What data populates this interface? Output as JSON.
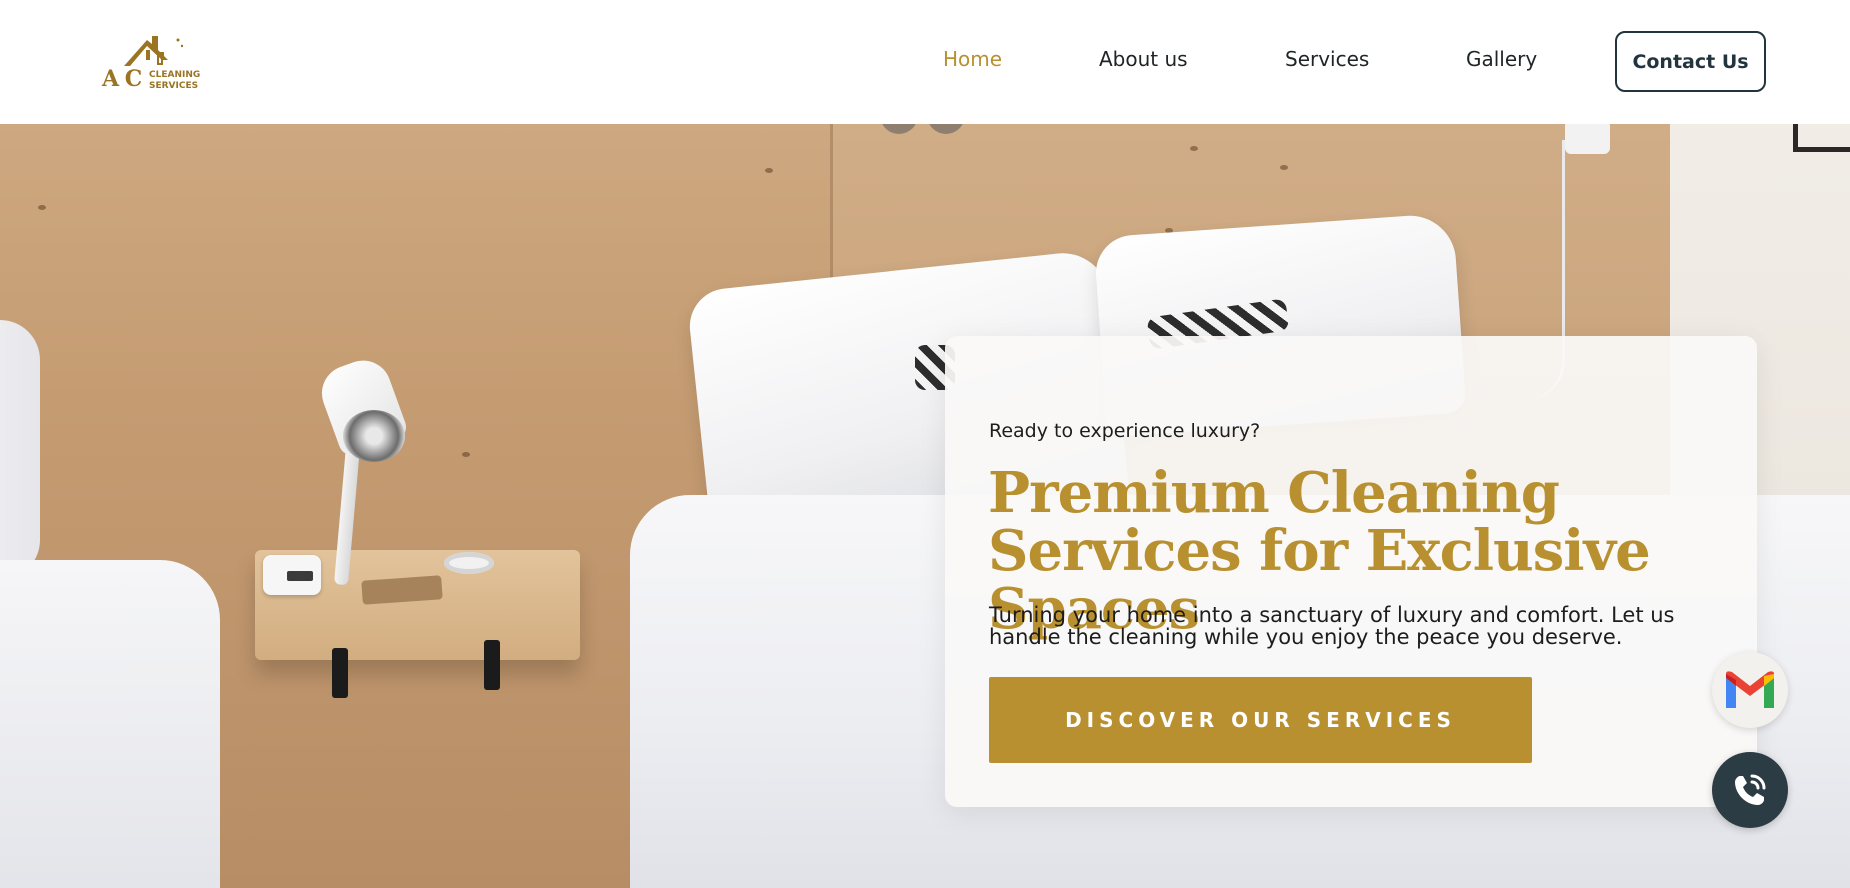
{
  "brand": {
    "logo_mark": "A C",
    "logo_line1": "CLEANING",
    "logo_line2": "SERVICES",
    "color_gold": "#b8902f",
    "color_dark": "#22343d"
  },
  "nav": {
    "items": [
      {
        "label": "Home",
        "active": true
      },
      {
        "label": "About us",
        "active": false
      },
      {
        "label": "Services",
        "active": false
      },
      {
        "label": "Gallery",
        "active": false
      }
    ],
    "contact_label": "Contact Us"
  },
  "hero": {
    "eyebrow": "Ready to experience luxury?",
    "headline": "Premium Cleaning Services for Exclusive Spaces",
    "description": "Turning your home into a sanctuary of luxury and comfort. Let us handle the cleaning while you enjoy the peace you deserve.",
    "cta_label": "DISCOVER OUR SERVICES"
  },
  "floating": {
    "mail_icon": "gmail-icon",
    "phone_icon": "phone-call-icon"
  }
}
